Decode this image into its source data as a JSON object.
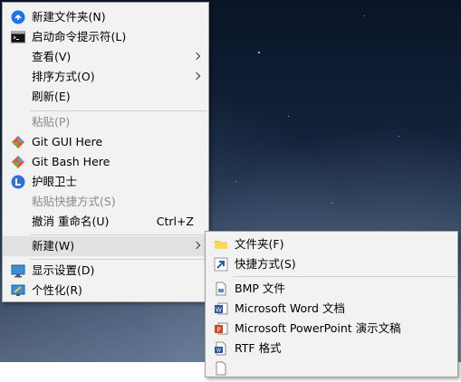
{
  "context_menu": {
    "items": [
      {
        "label": "新建文件夹(N)"
      },
      {
        "label": "启动命令提示符(L)"
      },
      {
        "label": "查看(V)"
      },
      {
        "label": "排序方式(O)"
      },
      {
        "label": "刷新(E)"
      },
      {
        "label": "粘贴(P)"
      },
      {
        "label": "Git GUI Here"
      },
      {
        "label": "Git Bash Here"
      },
      {
        "label": "护眼卫士"
      },
      {
        "label": "粘贴快捷方式(S)"
      },
      {
        "label": "撤消 重命名(U)",
        "shortcut": "Ctrl+Z"
      },
      {
        "label": "新建(W)"
      },
      {
        "label": "显示设置(D)"
      },
      {
        "label": "个性化(R)"
      }
    ]
  },
  "new_submenu": {
    "items": [
      {
        "label": "文件夹(F)"
      },
      {
        "label": "快捷方式(S)"
      },
      {
        "label": "BMP 文件"
      },
      {
        "label": "Microsoft Word 文档"
      },
      {
        "label": "Microsoft PowerPoint 演示文稿"
      },
      {
        "label": "RTF 格式"
      }
    ]
  },
  "colors": {
    "menu_bg": "#f2f2f2",
    "highlight": "#e1e1e1",
    "disabled_text": "#8a8a8a",
    "accent_blue": "#1a73e8"
  }
}
